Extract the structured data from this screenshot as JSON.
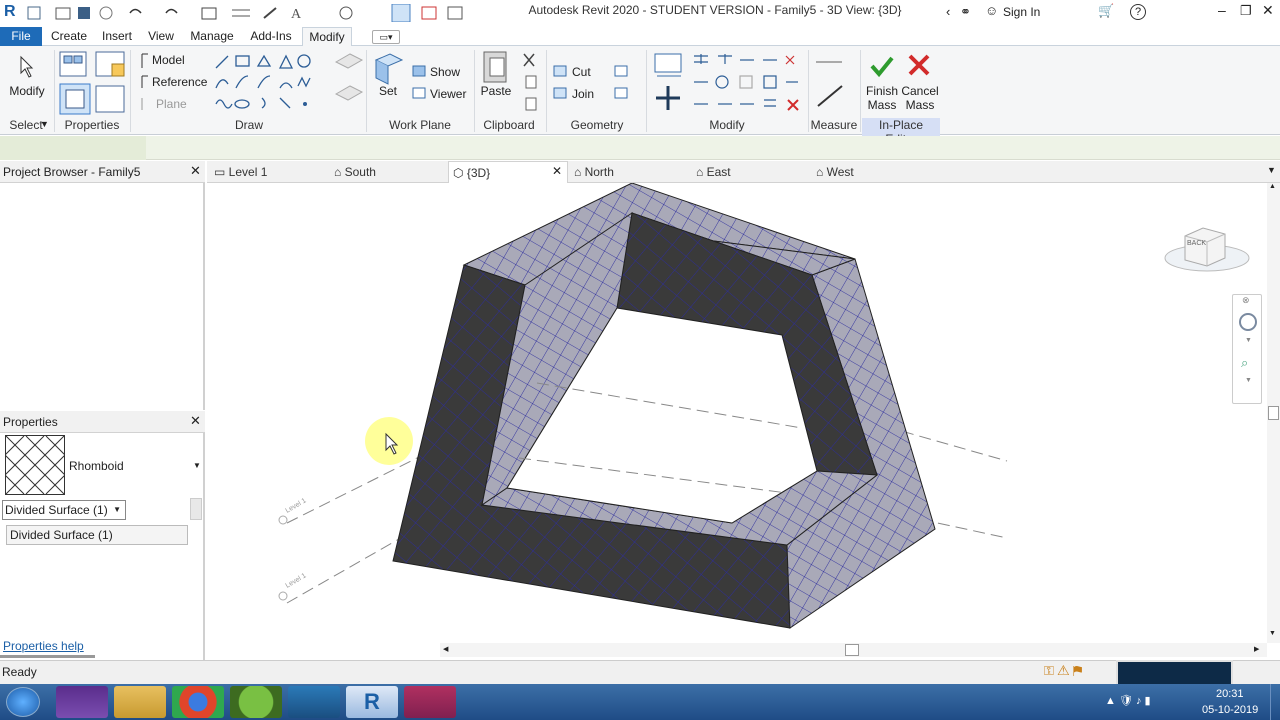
{
  "window": {
    "title": "Autodesk Revit 2020 - STUDENT VERSION - Family5 - 3D View: {3D}",
    "signin": "Sign In",
    "help": "?"
  },
  "ribbon_tabs": [
    "File",
    "Create",
    "Insert",
    "View",
    "Manage",
    "Add-Ins",
    "Modify"
  ],
  "ribbon": {
    "modify": "Modify",
    "draw": {
      "model": "Model",
      "reference": "Reference",
      "plane": "Plane"
    },
    "workplane": {
      "set": "Set",
      "show": "Show",
      "viewer": "Viewer"
    },
    "clipboard": {
      "paste": "Paste"
    },
    "geometry": {
      "cut": "Cut",
      "join": "Join"
    },
    "inplace": {
      "finish": "Finish",
      "finish2": "Mass",
      "cancel": "Cancel",
      "cancel2": "Mass"
    },
    "panels": {
      "select": "Select",
      "properties": "Properties",
      "draw": "Draw",
      "workplane": "Work Plane",
      "clipboard": "Clipboard",
      "geometry": "Geometry",
      "modify": "Modify",
      "measure": "Measure",
      "inplace_editor": "In-Place Editor"
    }
  },
  "project_browser": {
    "title": "Project Browser - Family5"
  },
  "properties": {
    "title": "Properties",
    "type_name": "Rhomboid",
    "filter": "Divided Surface (1)",
    "instance": "Divided Surface (1)",
    "help": "Properties help"
  },
  "view_tabs": [
    "Level 1",
    "South",
    "{3D}",
    "North",
    "East",
    "West"
  ],
  "viewcube": {
    "label": "BACK"
  },
  "level_labels": [
    "Level 1",
    "Level 1"
  ],
  "status": {
    "text": "Ready"
  },
  "clock": {
    "time": "20:31",
    "date": "05-10-2019"
  },
  "colors": {
    "accent": "#1b5fa6",
    "file_tab": "#1e6bb8",
    "mass_dark": "#3a3a3a",
    "mass_light": "#a9a9b8",
    "grid_line": "#1a1a9a",
    "green_check": "#2e9b2e",
    "red_x": "#d22b2b",
    "taskbar": "#2a5a96"
  }
}
